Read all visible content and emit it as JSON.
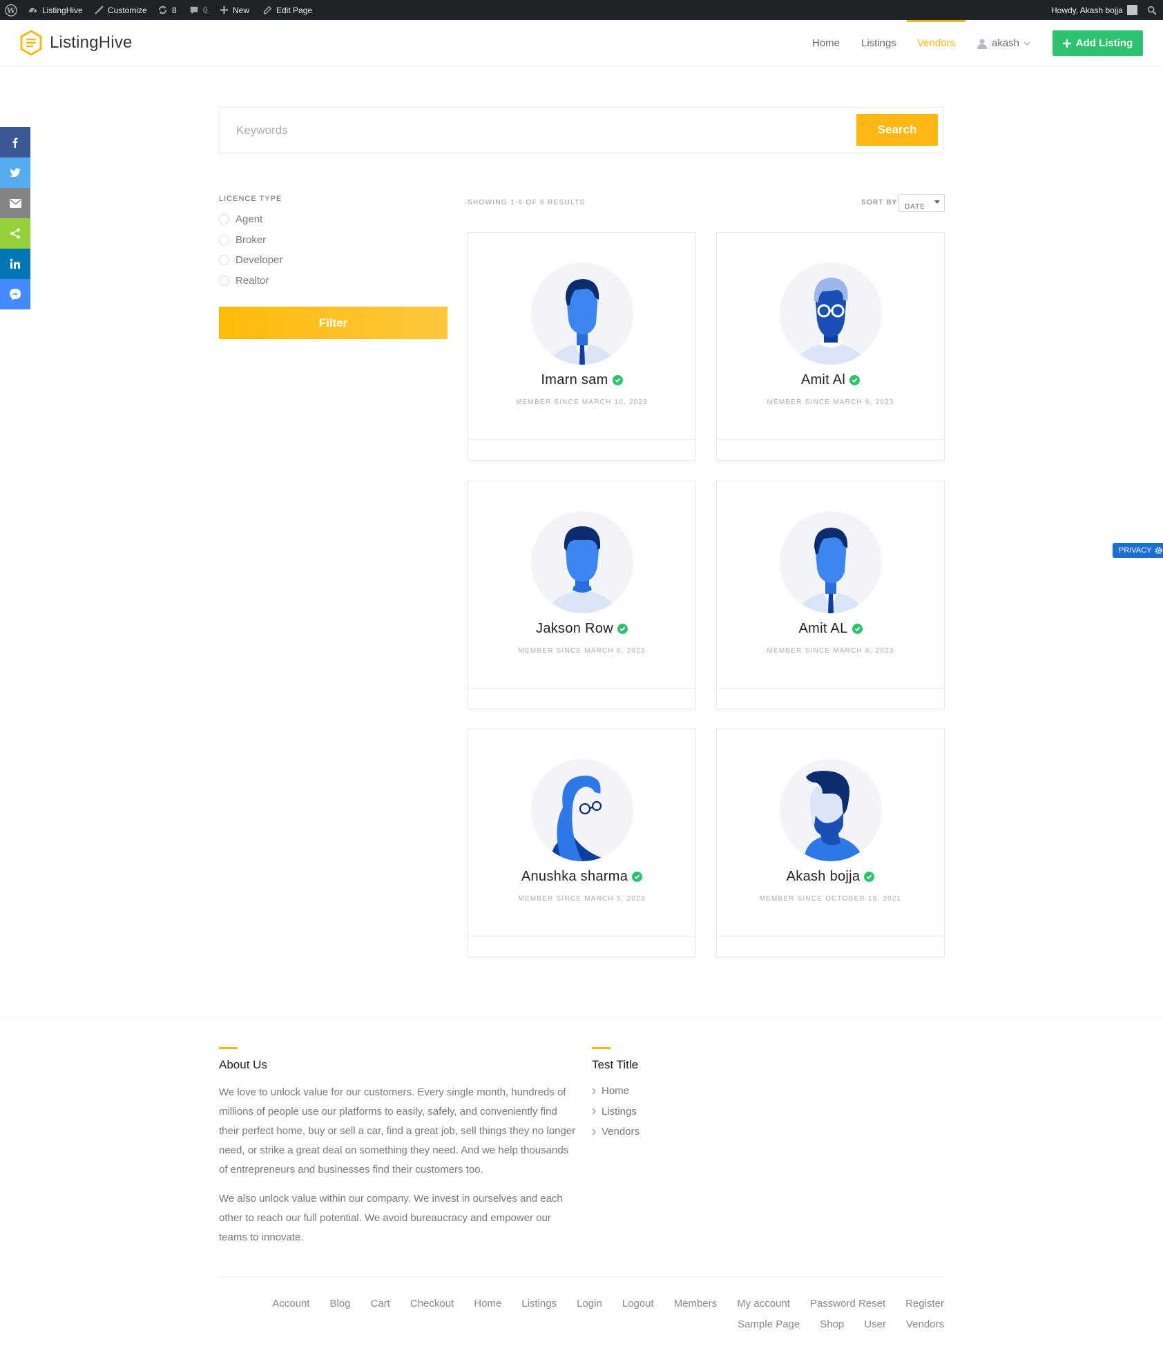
{
  "admin_bar": {
    "site_name": "ListingHive",
    "customize": "Customize",
    "updates_count": "8",
    "comments_count": "0",
    "new": "New",
    "edit_page": "Edit Page",
    "howdy": "Howdy, Akash bojja"
  },
  "header": {
    "brand": "ListingHive",
    "nav": [
      "Home",
      "Listings",
      "Vendors"
    ],
    "active_nav": "Vendors",
    "user": "akash",
    "add_listing": "Add Listing"
  },
  "share": [
    "facebook-icon",
    "twitter-icon",
    "email-icon",
    "share-icon",
    "linkedin-icon",
    "messenger-icon"
  ],
  "privacy": "PRIVACY",
  "search": {
    "placeholder": "Keywords",
    "value": "",
    "button": "Search"
  },
  "filter": {
    "title": "LICENCE TYPE",
    "options": [
      "Agent",
      "Broker",
      "Developer",
      "Realtor"
    ],
    "button": "Filter"
  },
  "results": {
    "count_text": "SHOWING 1-6 OF 6 RESULTS",
    "sort_label": "SORT BY",
    "sort_value": "DATE"
  },
  "vendors": [
    {
      "name": "Imarn sam",
      "since": "MEMBER SINCE MARCH 10, 2023",
      "avatar": "man-tie-avatar"
    },
    {
      "name": "Amit Al",
      "since": "MEMBER SINCE MARCH 9, 2023",
      "avatar": "man-glasses-avatar"
    },
    {
      "name": "Jakson Row",
      "since": "MEMBER SINCE MARCH 6, 2023",
      "avatar": "man-avatar"
    },
    {
      "name": "Amit AL",
      "since": "MEMBER SINCE MARCH 6, 2023",
      "avatar": "man-tie-avatar"
    },
    {
      "name": "Anushka sharma",
      "since": "MEMBER SINCE MARCH 5, 2023",
      "avatar": "woman-glasses-avatar"
    },
    {
      "name": "Akash bojja",
      "since": "MEMBER SINCE OCTOBER 19, 2021",
      "avatar": "man-beard-avatar"
    }
  ],
  "colors": {
    "accent": "#fcb712",
    "green": "#2ec26e",
    "admin_bar": "#1d2327",
    "avatar_blue": "#2f78ea"
  },
  "footer": {
    "about_title": "About Us",
    "about_paragraphs": [
      "We love to unlock value for our customers. Every single month, hundreds of millions of people use our platforms to easily, safely, and conveniently find their perfect home, buy or sell a car, find a great job, sell things they no longer need, or strike a great deal on something they need. And we help thousands of entrepreneurs and businesses find their customers too.",
      "We also unlock value within our company. We invest in ourselves and each other to reach our full potential. We avoid bureaucracy and empower our teams to innovate."
    ],
    "links_title": "Test Title",
    "links": [
      "Home",
      "Listings",
      "Vendors"
    ],
    "bottom_nav": [
      "Account",
      "Blog",
      "Cart",
      "Checkout",
      "Home",
      "Listings",
      "Login",
      "Logout",
      "Members",
      "My account",
      "Password Reset",
      "Register",
      "Sample Page",
      "Shop",
      "User",
      "Vendors"
    ]
  }
}
